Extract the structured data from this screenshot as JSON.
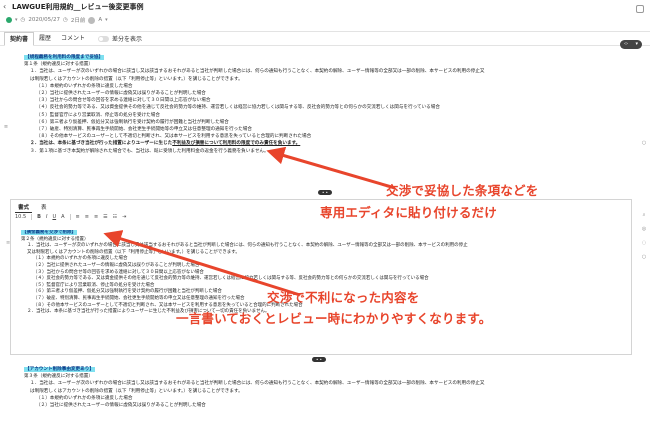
{
  "header": {
    "back_icon": "back-arrow-icon",
    "title": "LAWGUE利用規約__レビュー後変更事例",
    "date": "2020/05/27",
    "edits": "2日前",
    "user_initial": "A",
    "status_color": "#2aa86c"
  },
  "tabs": [
    {
      "label": "契約書"
    },
    {
      "label": "履歴"
    },
    {
      "label": "コメント"
    }
  ],
  "toggle_label": "差分を表示",
  "section_top": {
    "heading": "【規程義務を利用料の限度まで妥協】",
    "lines": [
      "第１条（規約違反に対する措置）",
      "１．当社は、ユーザーが次のいずれかの場合に該当し又は該当するおそれがあると当社が判断した場合には、何らの通知も行うことなく、本契約の解除、ユーザー情報等の全部又は一部の削除、本サービスの利用の停止又",
      "は制限若しくはアカウントの削除の措置（以下「利用停止等」といいます。）を講じることができます。",
      "（１）本規約のいずれかの条項に違反した場合",
      "（２）当社に提供されたユーザーの情報に虚偽又は誤りがあることが判明した場合",
      "（３）当社からの問合せ等の回答を求める連絡に対して３０日間以上応答がない場合",
      "（４）反社会的勢力等である、又は資金提供その他を通じて反社会的勢力等の維持、運営若しくは経営に協力若しくは関与する等、反社会的勢力等との何らかの交流若しくは関与を行っている場合",
      "（５）監督官庁により営業取消、停止等の処分を受けた場合",
      "（６）第三者より仮差押、仮処分又は強制執行を受け契約の履行が困難と当社が判断した場合",
      "（７）破産、特別清算、民事再生手続開始、会社更生手続開始等の申立又は任意整理の通知を行った場合",
      "（８）その他本サービスのユーザーとして不適切と判断され、又は本サービスを利用する意思を失っていると合理的に判断された場合"
    ],
    "line2_bold_a": "２．当社は、本条に基づき当社が行った措置によりユーザーに生じた",
    "line2_bold_b": "不利益及び損害について利用料の限度でのみ責任を負います。",
    "line3": "３．第１項に基づき本契約が解除された場合でも、当社は、既に受領した利用料金の返金を行う義務を負いません。"
  },
  "editor": {
    "tabs": [
      {
        "label": "書式"
      },
      {
        "label": "表"
      }
    ],
    "font_size": "10.5",
    "toolbar_icons": [
      "bold-icon",
      "italic-icon",
      "underline-icon",
      "color-icon",
      "align-left-icon",
      "align-center-icon",
      "align-right-icon",
      "list-icon",
      "ordered-list-icon",
      "indent-icon"
    ],
    "heading": "【損金義務を交渉で削除】",
    "lines": [
      "第２条（規約違反に対する措置）",
      "１．当社は、ユーザーが次のいずれかの場合に該当し又は該当するおそれがあると当社が判断した場合には、何らの通知も行うことなく、本契約の解除、ユーザー情報等の全部又は一部の削除、本サービスの利用の停止",
      "又は制限若しくはアカウントの削除の措置（以下「利用停止等」といいます。）を講じることができます。",
      "（１）本規約のいずれかの条項に違反した場合",
      "（２）当社に提供されたユーザーの情報に虚偽又は誤りがあることが判明した場合",
      "（３）当社からの問合せ等の回答を求める連絡に対して３０日間以上応答がない場合",
      "（４）反社会的勢力等である、又は資金提供その他を通じて反社会的勢力等の維持、運営若しくは経営に協力若しくは関与する等、反社会的勢力等との何らかの交流若しくは関与を行っている場合",
      "（５）監督官庁により営業取消、停止等の処分を受けた場合",
      "（６）第三者より仮差押、仮処分又は強制執行を受け契約の履行が困難と当社が判断した場合",
      "（７）破産、特別清算、民事再生手続開始、会社更生手続開始等の申立又は任意整理の通知を行った場合",
      "（８）その他本サービスのユーザーとして不適切と判断され、又は本サービスを利用する意思を失っていると合理的に判断された場合",
      "２．当社は、本条に基づき当社が行った措置によりユーザーに生じた不利益及び損害について一切の責任を負いません。"
    ]
  },
  "section_bottom": {
    "heading": "【アカウント削除事由変更あり】",
    "lines": [
      "第３条（規約違反に対する措置）",
      "１．当社は、ユーザーが次のいずれかの場合に該当し又は該当するおそれがあると当社が判断した場合には、何らの通知も行うことなく、本契約の解除、ユーザー情報等の全部又は一部の削除、本サービスの利用の停止又",
      "は制限若しくはアカウントの削除の措置（以下「利用停止等」といいます。）を講じることができます。",
      "（１）本規約のいずれかの条項に違反した場合",
      "（２）当社に提供されたユーザーの情報に虚偽又は誤りがあることが判明した場合"
    ]
  },
  "annotations": {
    "callout1_line1": "交渉で妥協した条項などを",
    "callout1_line2": "専用エディタに貼り付けるだけ",
    "callout2_line1": "交渉で不利になった内容を",
    "callout2_line2": "一言書いておくとレビュー時にわかりやすくなります。",
    "color": "#e8452c"
  }
}
